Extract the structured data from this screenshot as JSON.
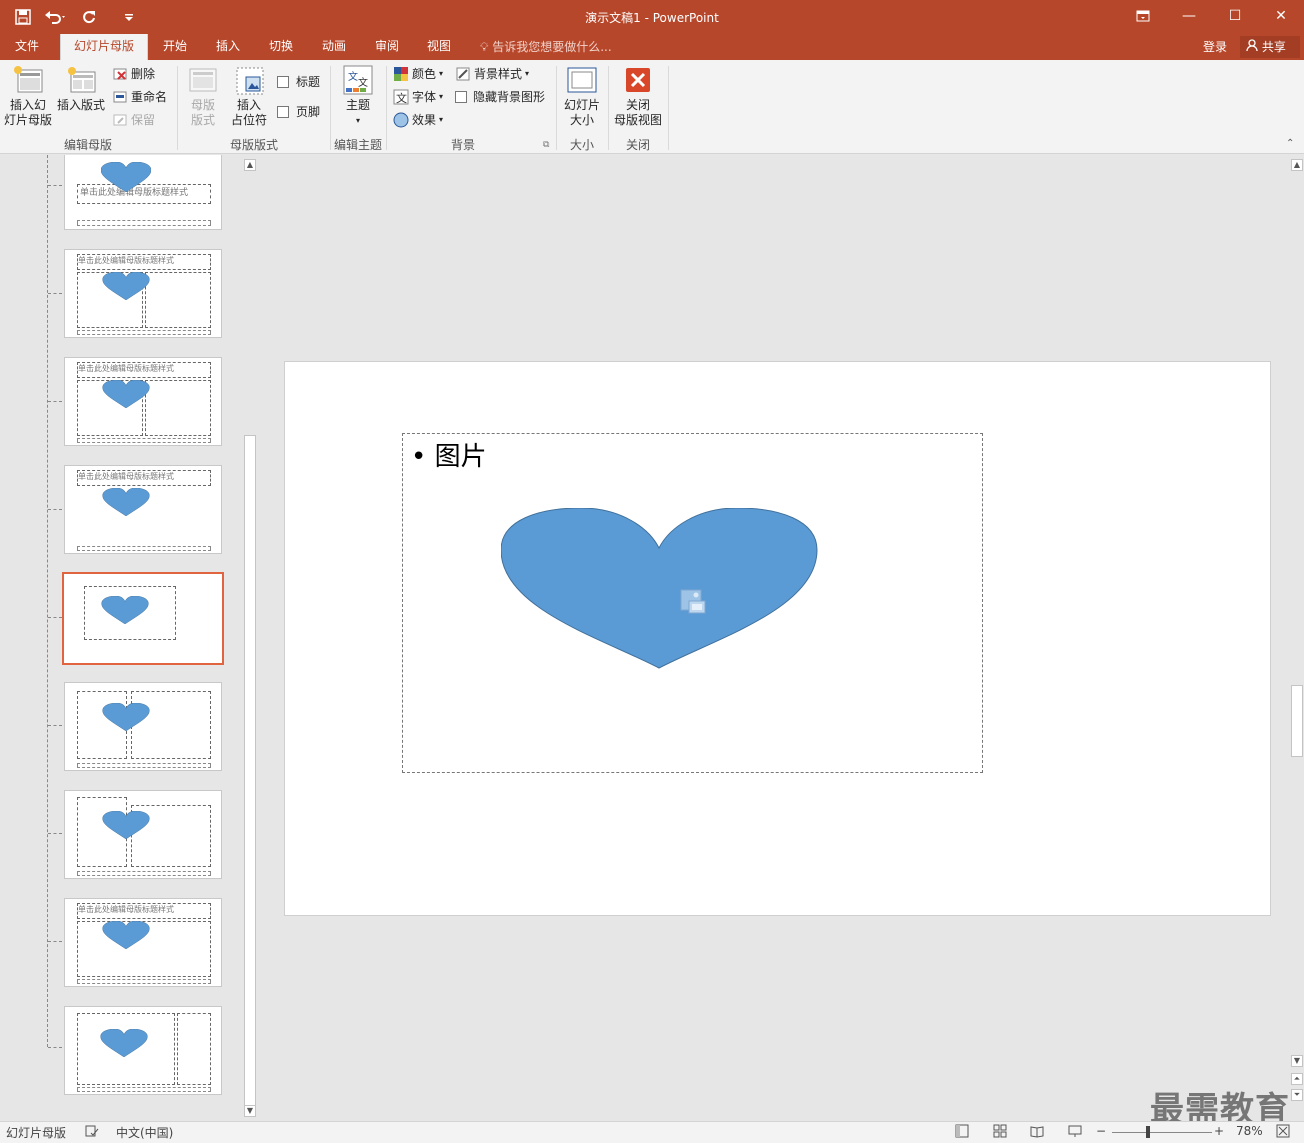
{
  "window": {
    "title": "演示文稿1 - PowerPoint",
    "restore_icon": "ribbon-display-icon",
    "minimize": "—",
    "maximize": "☐",
    "close": "✕"
  },
  "qat": {
    "save": "save-icon",
    "undo": "undo-icon",
    "redo": "redo-icon",
    "customize": "customize-icon"
  },
  "tabs": [
    {
      "label": "文件"
    },
    {
      "label": "幻灯片母版"
    },
    {
      "label": "开始"
    },
    {
      "label": "插入"
    },
    {
      "label": "切换"
    },
    {
      "label": "动画"
    },
    {
      "label": "审阅"
    },
    {
      "label": "视图"
    }
  ],
  "tellme": "告诉我您想要做什么...",
  "login": "登录",
  "share": "共享",
  "ribbon": {
    "insert_master": "插入幻\n灯片母版",
    "insert_layout": "插入版式",
    "delete": "删除",
    "rename": "重命名",
    "preserve": "保留",
    "group_edit_master": "编辑母版",
    "master_layout": "母版\n版式",
    "insert_placeholder": "插入\n占位符",
    "title_chk": "标题",
    "footer_chk": "页脚",
    "group_master_layout": "母版版式",
    "themes": "主题",
    "group_edit_theme": "编辑主题",
    "colors": "颜色",
    "fonts": "字体",
    "effects": "效果",
    "bg_styles": "背景样式",
    "hide_bg": "隐藏背景图形",
    "group_background": "背景",
    "slide_size": "幻灯片\n大小",
    "group_size": "大小",
    "close_master": "关闭\n母版视图",
    "group_close": "关闭"
  },
  "thumbs": {
    "title_text": "单击此处编辑母版标题样式"
  },
  "slide": {
    "bullet": "•",
    "placeholder_text": "图片",
    "shape_color": "#5b9bd5"
  },
  "status": {
    "view": "幻灯片母版",
    "lang": "中文(中国)",
    "zoom": "78%"
  },
  "watermark": "最需教育"
}
